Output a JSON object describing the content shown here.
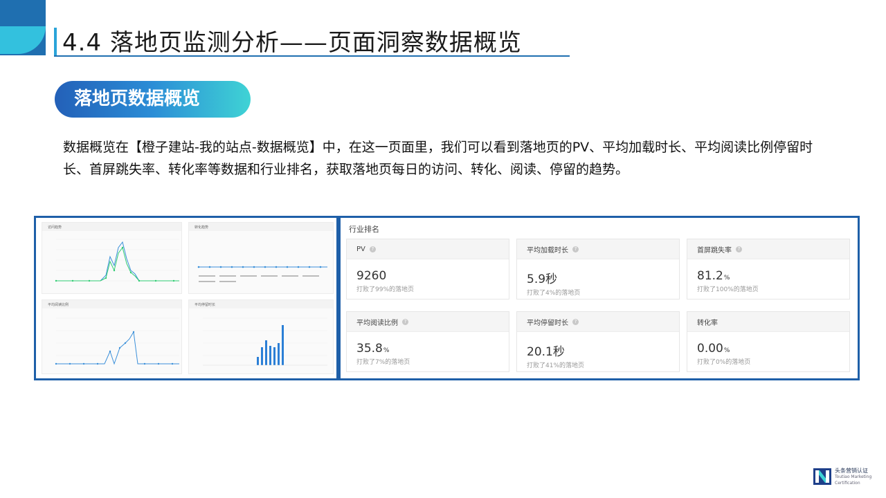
{
  "title": "4.4 落地页监测分析——页面洞察数据概览",
  "section_pill": "落地页数据概览",
  "description": "数据概览在【橙子建站-我的站点-数据概览】中，在这一页面里，我们可以看到落地页的PV、平均加载时长、平均阅读比例停留时长、首屏跳失率、转化率等数据和行业排名，获取落地页每日的访问、转化、阅读、停留的趋势。",
  "left_panel": {
    "charts": [
      {
        "title": "访问趋势"
      },
      {
        "title": "转化趋势"
      },
      {
        "title": "平均阅读比例"
      },
      {
        "title": "平均停留时长"
      }
    ]
  },
  "industry_rank": {
    "title": "行业排名",
    "cards": [
      {
        "label": "PV",
        "value": "9260",
        "unit": "",
        "sub": "打败了99%的落地页"
      },
      {
        "label": "平均加载时长",
        "value": "5.9秒",
        "unit": "",
        "sub": "打败了4%的落地页"
      },
      {
        "label": "首屏跳失率",
        "value": "81.2",
        "unit": "%",
        "sub": "打败了100%的落地页"
      },
      {
        "label": "平均阅读比例",
        "value": "35.8",
        "unit": "%",
        "sub": "打败了7%的落地页"
      },
      {
        "label": "平均停留时长",
        "value": "20.1秒",
        "unit": "",
        "sub": "打败了41%的落地页"
      },
      {
        "label": "转化率",
        "value": "0.00",
        "unit": "%",
        "sub": "打败了0%的落地页"
      }
    ]
  },
  "brand": {
    "cn": "头条营销认证",
    "en1": "Toutiao Marketing",
    "en2": "Certification"
  },
  "colors": {
    "accent": "#1e5fa8",
    "line_green": "#2ecc71",
    "line_blue": "#3a8fd9",
    "bar_blue": "#2b7fd6"
  }
}
